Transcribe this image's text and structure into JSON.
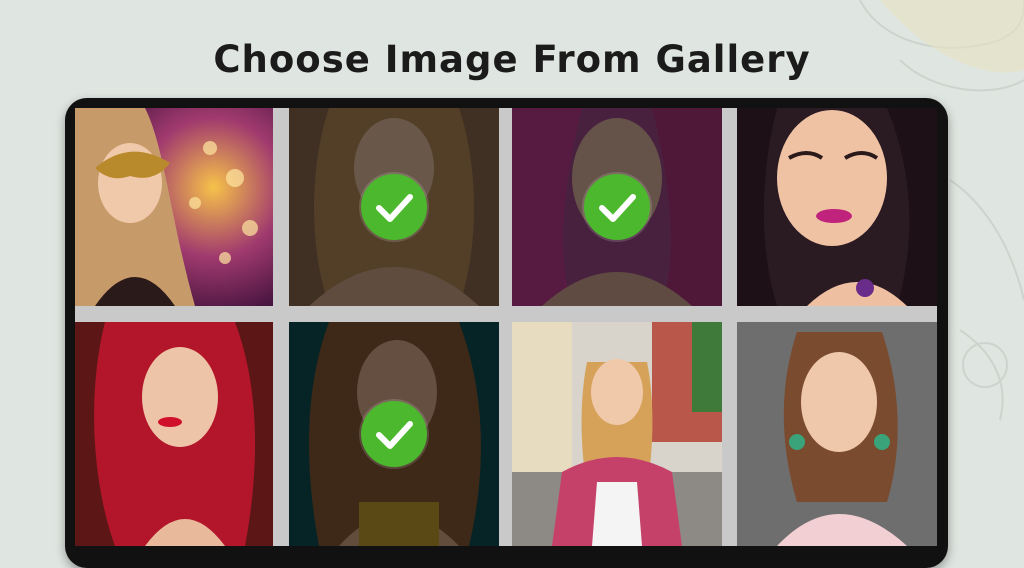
{
  "header": {
    "title": "Choose Image From Gallery"
  },
  "gallery": {
    "items": [
      {
        "subject": "woman in gold masquerade mask with bokeh lights",
        "selected": false
      },
      {
        "subject": "blonde woman portrait",
        "selected": true
      },
      {
        "subject": "woman with pink hair",
        "selected": true
      },
      {
        "subject": "woman with purple lipstick",
        "selected": false
      },
      {
        "subject": "woman with red hair",
        "selected": false
      },
      {
        "subject": "woman with long brown hair",
        "selected": true
      },
      {
        "subject": "woman taking selfie on street",
        "selected": false
      },
      {
        "subject": "woman with earrings on grey backdrop",
        "selected": false
      }
    ]
  },
  "colors": {
    "check": "#4cb82d",
    "frame": "#111111",
    "background": "#dfe5e0"
  }
}
